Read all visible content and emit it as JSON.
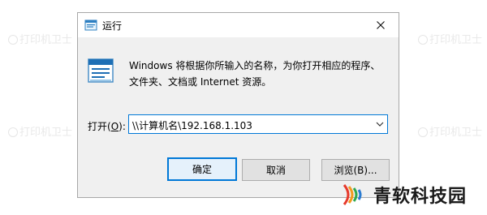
{
  "watermark": {
    "text": "打印机卫士"
  },
  "window": {
    "title": "运行",
    "close_glyph": "✕",
    "description": "Windows 将根据你所输入的名称，为你打开相应的程序、文件夹、文档或 Internet 资源。",
    "open_label_prefix": "打开(",
    "open_label_hotkey": "O",
    "open_label_suffix": "):",
    "combo_value": "\\\\计算机名\\192.168.1.103"
  },
  "buttons": {
    "ok": "确定",
    "cancel": "取消",
    "browse": "浏览(B)..."
  },
  "brand": {
    "text": "青软科技园"
  },
  "icons": {
    "title": "run-app-icon",
    "big": "run-app-icon",
    "close": "close-icon",
    "dropdown": "chevron-down-icon",
    "brand": "sound-wave-logo"
  },
  "colors": {
    "accent": "#0078d7",
    "window_bg": "#f0f0f0",
    "button_bg": "#e1e1e1"
  }
}
